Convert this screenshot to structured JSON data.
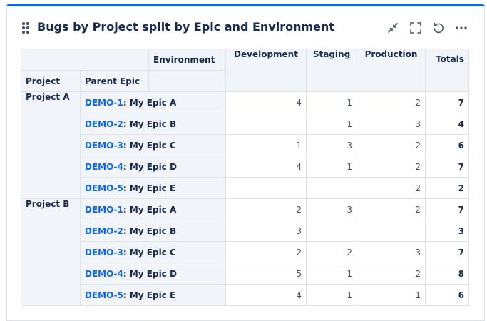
{
  "title": "Bugs by Project split by Epic and Environment",
  "header_icons": [
    "collapse-icon",
    "fullscreen-icon",
    "refresh-icon",
    "more-icon"
  ],
  "table": {
    "col_dimension": "Environment",
    "row_dim_1": "Project",
    "row_dim_2": "Parent Epic",
    "columns": [
      "Development",
      "Staging",
      "Production",
      "Totals"
    ],
    "projects": [
      {
        "name": "Project A",
        "rows": [
          {
            "key": "DEMO-1",
            "summary": ": My Epic A",
            "values": [
              "4",
              "1",
              "2"
            ],
            "total": "7"
          },
          {
            "key": "DEMO-2",
            "summary": ": My Epic B",
            "values": [
              "",
              "1",
              "3"
            ],
            "total": "4"
          },
          {
            "key": "DEMO-3",
            "summary": ": My Epic C",
            "values": [
              "1",
              "3",
              "2"
            ],
            "total": "6"
          },
          {
            "key": "DEMO-4",
            "summary": ": My Epic D",
            "values": [
              "4",
              "1",
              "2"
            ],
            "total": "7"
          },
          {
            "key": "DEMO-5",
            "summary": ": My Epic E",
            "values": [
              "",
              "",
              "2"
            ],
            "total": "2"
          }
        ]
      },
      {
        "name": "Project B",
        "rows": [
          {
            "key": "DEMO-1",
            "summary": ": My Epic A",
            "values": [
              "2",
              "3",
              "2"
            ],
            "total": "7"
          },
          {
            "key": "DEMO-2",
            "summary": ": My Epic B",
            "values": [
              "3",
              "",
              ""
            ],
            "total": "3"
          },
          {
            "key": "DEMO-3",
            "summary": ": My Epic C",
            "values": [
              "2",
              "2",
              "3"
            ],
            "total": "7"
          },
          {
            "key": "DEMO-4",
            "summary": ": My Epic D",
            "values": [
              "5",
              "1",
              "2"
            ],
            "total": "8"
          },
          {
            "key": "DEMO-5",
            "summary": ": My Epic E",
            "values": [
              "4",
              "1",
              "1"
            ],
            "total": "6"
          }
        ]
      }
    ]
  }
}
